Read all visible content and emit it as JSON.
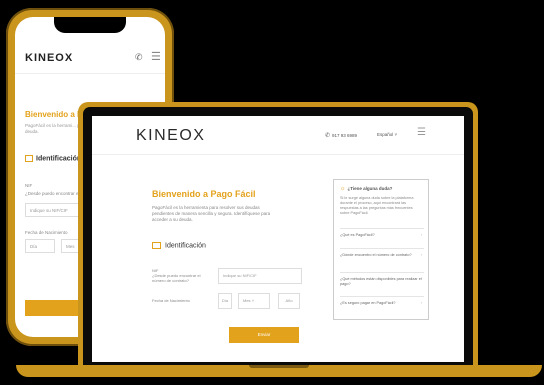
{
  "brand": {
    "logo": "KINEOX",
    "accent": "#e3a21c",
    "frame": "#c9951c"
  },
  "header": {
    "phone": "917 93 6989",
    "language": "Español"
  },
  "page": {
    "title": "Bienvenido a Pago Fácil",
    "intro": "PagoFácil es la herramienta para resolver sus deudas pendientes de manera sencilla y segura. Identifíquese para acceder a su deuda.",
    "phone_intro": "PagoFácil es la herrami... pendientes de manera s... acceder a su deuda.",
    "section_title": "Identificación",
    "nif_label": "NIF",
    "nif_question": "¿Desde puedo encontrar el número de contrato?",
    "nif_placeholder": "Indique su NIF/CIF",
    "birth_label": "Fecha de Nacimiento",
    "day_placeholder": "Día",
    "month_placeholder": "Mes",
    "year_placeholder": "Año",
    "submit_label": "Enviar"
  },
  "help": {
    "title": "¿Tiene alguna duda?",
    "text": "Si le surge alguna duda sobre la plataforma durante el proceso, aquí encontrará las respuestas a las preguntas más frecuentes sobre PagoFácil.",
    "items": [
      "¿Qué es PagoFácil?",
      "¿Dónde encuentro el número de contrato?",
      "¿Qué métodos están disponibles para realizar el pago?",
      "¿Es seguro pagar en PagoFácil?"
    ]
  }
}
